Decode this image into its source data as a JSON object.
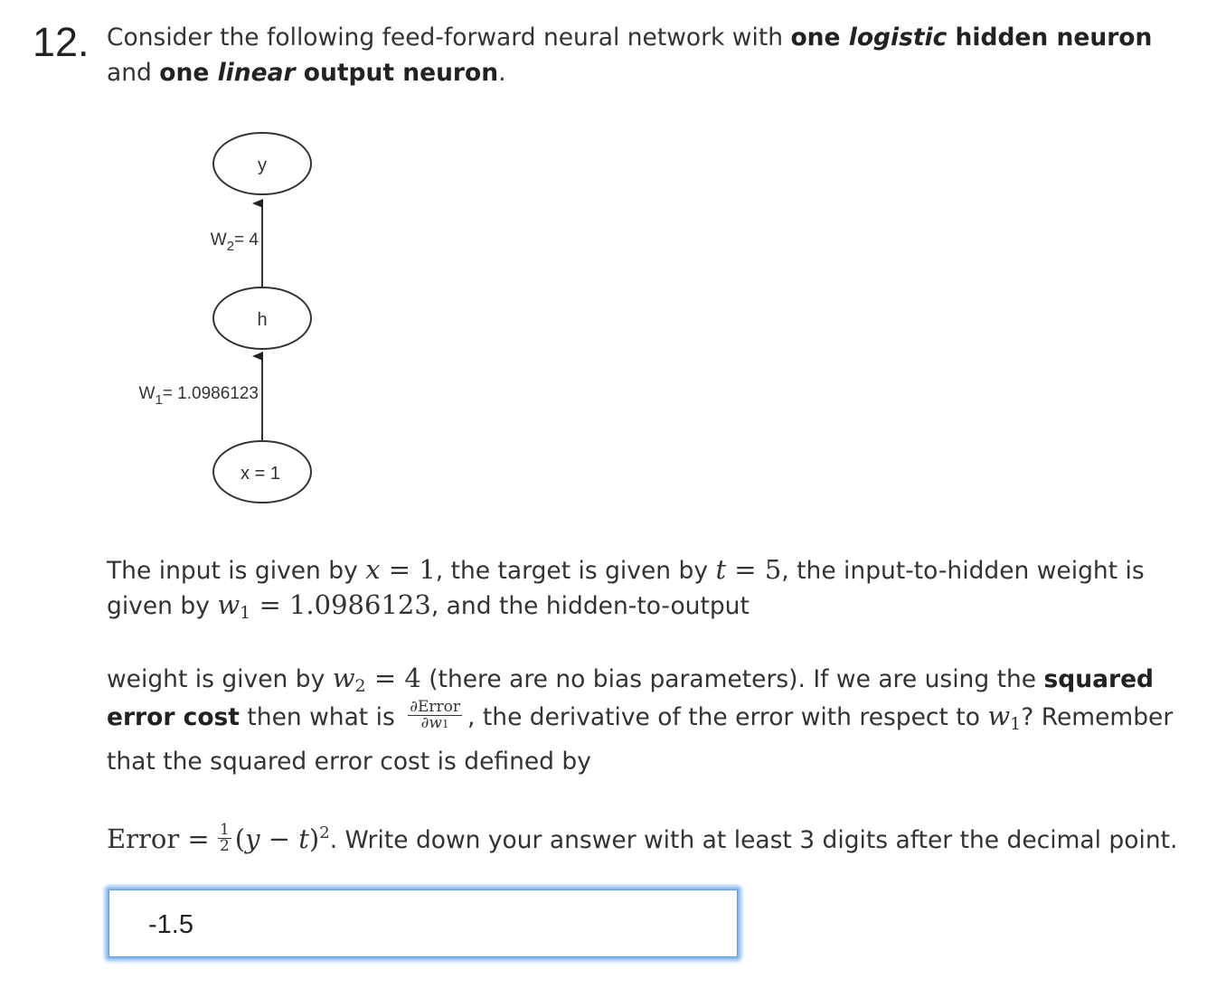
{
  "question": {
    "number": "12.",
    "intro": {
      "t1": "Consider the following feed-forward neural network with ",
      "b1": "one ",
      "bi1": "logistic",
      "b2": " hidden neuron",
      "t2": "and ",
      "b3": "one ",
      "bi2": "linear",
      "b4": " output neuron",
      "t3": "."
    },
    "diagram": {
      "output_node": "y",
      "hidden_node": "h",
      "input_node": "x = 1",
      "w2_label": "W",
      "w2_sub": "2",
      "w2_value": "= 4",
      "w1_label": "W",
      "w1_sub": "1",
      "w1_value": "= 1.0986123"
    },
    "para1": {
      "a": "The input is given by ",
      "x_var": "x",
      "eq1": " = 1",
      "b": ", the target is given by ",
      "t_var": "t",
      "eq2": " = 5",
      "c": ", the input-to-hidden weight is",
      "d": "given by ",
      "w_var": "w",
      "w_sub": "1",
      "eq3": " = 1.0986123",
      "e": ", and the hidden-to-output"
    },
    "para2": {
      "a": "weight is given by ",
      "w_var": "w",
      "w_sub": "2",
      "eq": " = 4",
      "b": " (there are no bias parameters). If we are using the ",
      "bold1": "squared",
      "bold2": "error cost",
      "c": " then what is ",
      "frac_num": "∂Error",
      "frac_den_d": "∂",
      "frac_den_w": "w",
      "frac_den_sub": "1",
      "d": ", the derivative of the error with respect to ",
      "w1_var": "w",
      "w1_sub": "1",
      "e": "? Remember",
      "f": "that the squared error cost is defined by"
    },
    "para3": {
      "error": "Error",
      "eq": " = ",
      "half_num": "1",
      "half_den": "2",
      "paren_open": "(",
      "y_var": "y",
      "minus": " − ",
      "t_var": "t",
      "paren_close": ")",
      "exp": "2",
      "rest": ". Write down your answer with at least 3 digits after the decimal point."
    }
  },
  "answer": {
    "value": "-1.5"
  }
}
